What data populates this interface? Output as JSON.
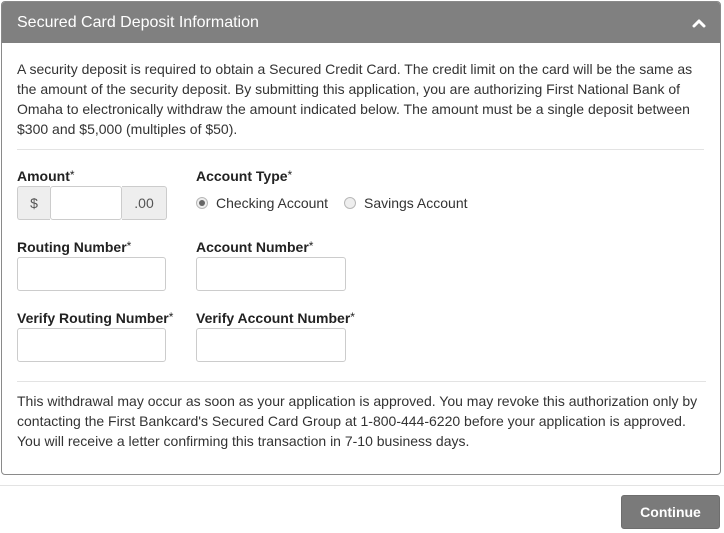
{
  "panel": {
    "title": "Secured Card Deposit Information",
    "collapse_icon": "chevron-up-icon",
    "intro": "A security deposit is required to obtain a Secured Credit Card. The credit limit on the card will be the same as the amount of the security deposit. By submitting this application, you are authorizing First National Bank of Omaha to electronically withdraw the amount indicated below. The amount must be a single deposit between $300 and $5,000 (multiples of $50).",
    "footer_text": "This withdrawal may occur as soon as your application is approved. You may revoke this authorization only by contacting the First Bankcard's Secured Card Group at 1-800-444-6220 before your application is approved. You will receive a letter confirming this transaction in 7-10 business days."
  },
  "form": {
    "required_mark": "*",
    "amount": {
      "label": "Amount",
      "prefix": "$",
      "suffix": ".00",
      "value": ""
    },
    "account_type": {
      "label": "Account Type",
      "options": [
        {
          "label": "Checking Account",
          "selected": true
        },
        {
          "label": "Savings Account",
          "selected": false
        }
      ]
    },
    "routing_number": {
      "label": "Routing Number",
      "value": ""
    },
    "account_number": {
      "label": "Account Number",
      "value": ""
    },
    "verify_routing_number": {
      "label": "Verify Routing Number",
      "value": ""
    },
    "verify_account_number": {
      "label": "Verify Account Number",
      "value": ""
    }
  },
  "actions": {
    "continue_label": "Continue"
  }
}
